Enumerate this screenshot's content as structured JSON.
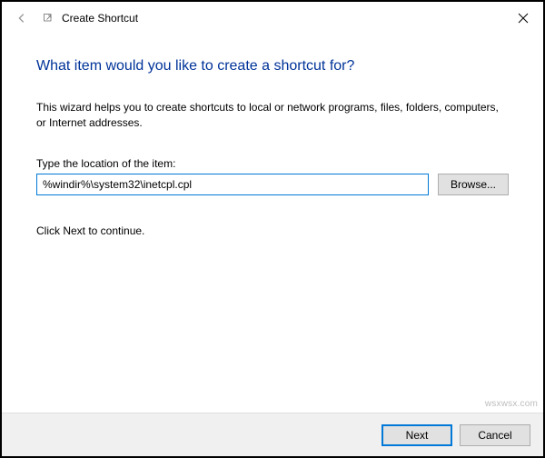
{
  "window": {
    "title": "Create Shortcut"
  },
  "heading": "What item would you like to create a shortcut for?",
  "description": "This wizard helps you to create shortcuts to local or network programs, files, folders, computers, or Internet addresses.",
  "field": {
    "label": "Type the location of the item:",
    "value": "%windir%\\system32\\inetcpl.cpl",
    "browse_label": "Browse..."
  },
  "continue_text": "Click Next to continue.",
  "footer": {
    "next_label": "Next",
    "cancel_label": "Cancel"
  },
  "watermark": "wsxwsx.com"
}
